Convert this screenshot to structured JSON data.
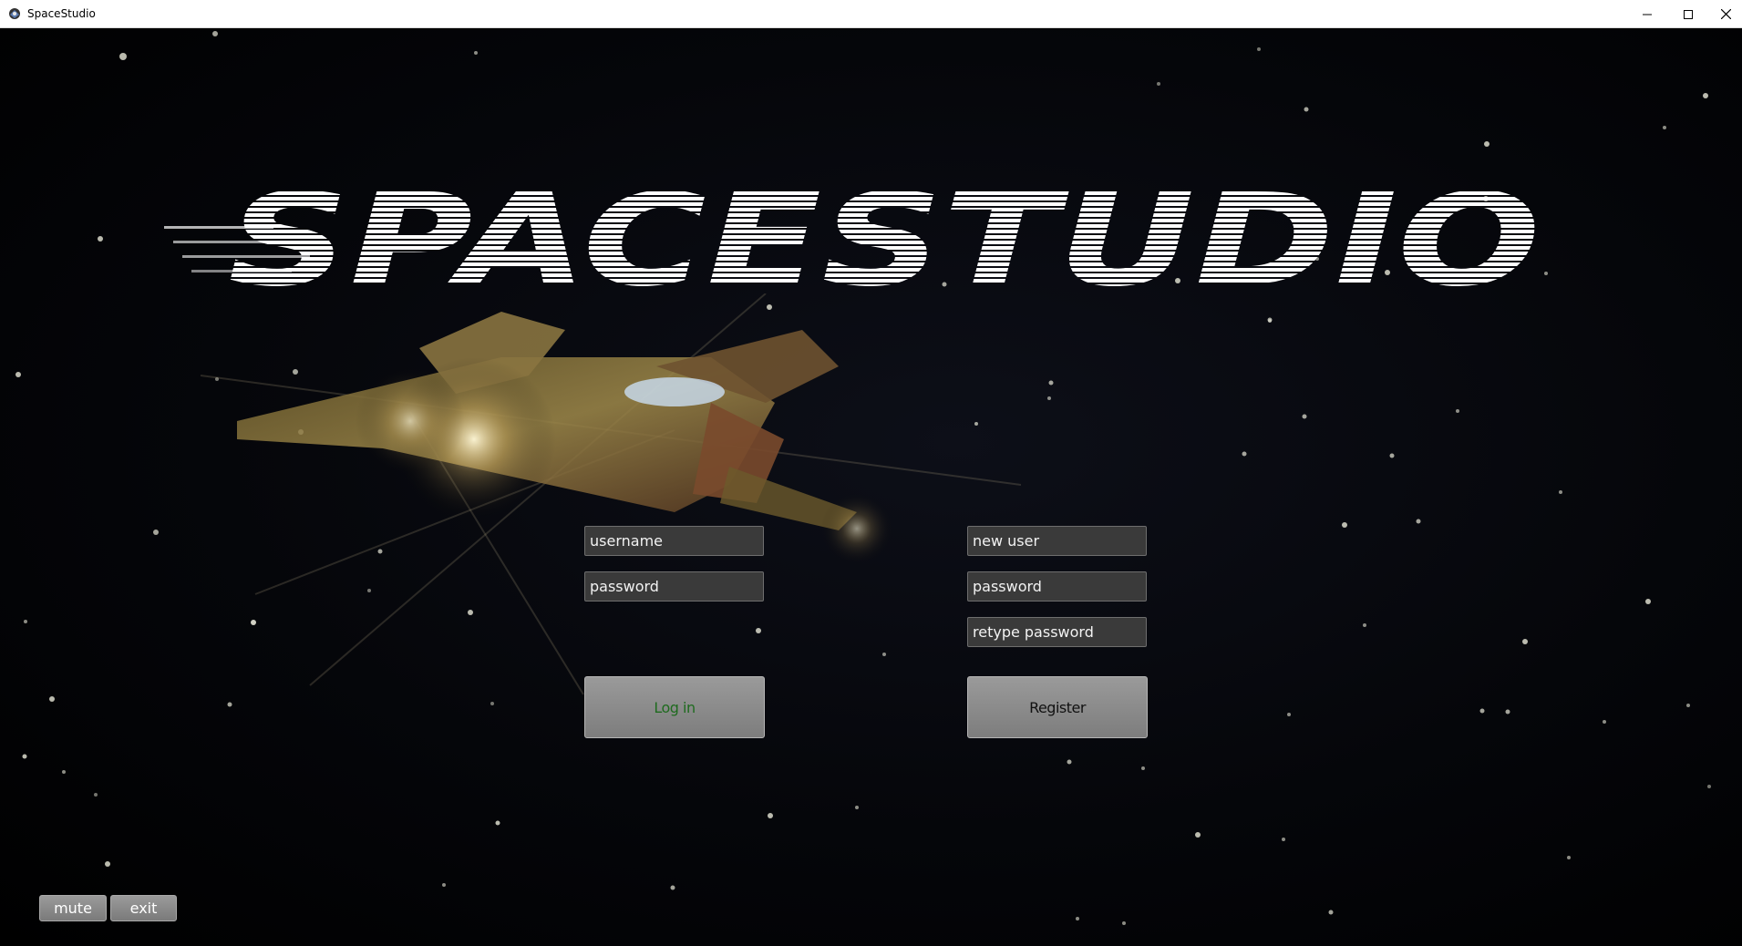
{
  "window": {
    "title": "SpaceStudio",
    "controls": {
      "minimize_icon": "minimize-icon",
      "maximize_icon": "maximize-icon",
      "close_icon": "close-icon"
    }
  },
  "branding": {
    "logo_text": "SPACESTUDIO"
  },
  "login": {
    "username_placeholder": "username",
    "password_placeholder": "password",
    "button_label": "Log in",
    "button_text_color": "#1f6b1f"
  },
  "register": {
    "new_user_placeholder": "new user",
    "password_placeholder": "password",
    "retype_placeholder": "retype password",
    "button_label": "Register",
    "button_text_color": "#111111"
  },
  "footer": {
    "mute_label": "mute",
    "exit_label": "exit"
  }
}
